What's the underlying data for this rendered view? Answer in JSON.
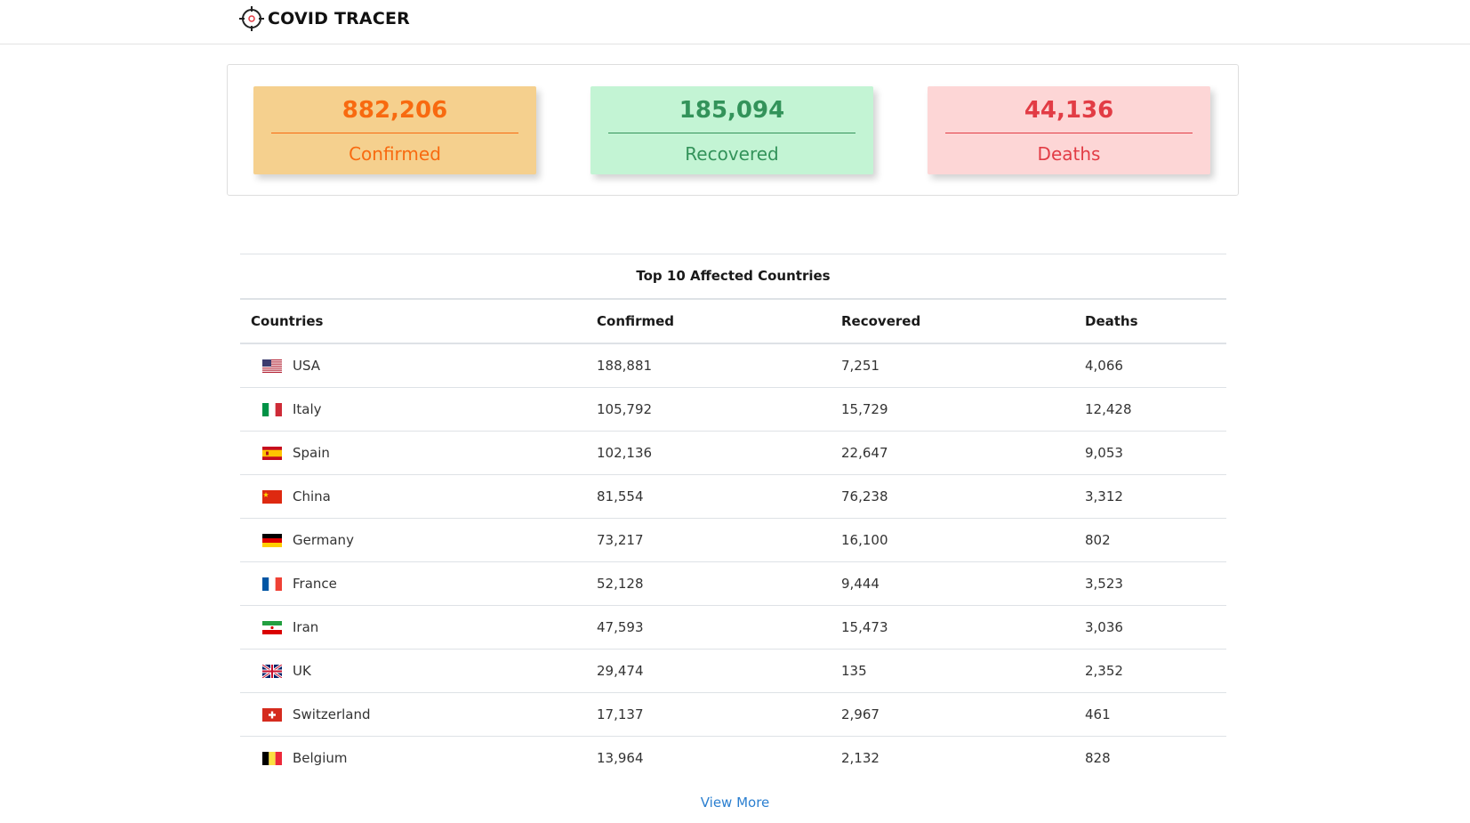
{
  "header": {
    "brand_title": "COVID TRACER",
    "brand_icon": "crosshair-icon"
  },
  "stats": {
    "confirmed": {
      "value": "882,206",
      "label": "Confirmed",
      "color": "#f86a10",
      "bg": "#f5d08e"
    },
    "recovered": {
      "value": "185,094",
      "label": "Recovered",
      "color": "#33935a",
      "bg": "#c3f4d4"
    },
    "deaths": {
      "value": "44,136",
      "label": "Deaths",
      "color": "#e23c45",
      "bg": "#fdd6d6"
    }
  },
  "table": {
    "caption": "Top 10 Affected Countries",
    "columns": [
      "Countries",
      "Confirmed",
      "Recovered",
      "Deaths"
    ],
    "rows": [
      {
        "country": "USA",
        "flag": "us-flag-icon",
        "confirmed": "188,881",
        "recovered": "7,251",
        "deaths": "4,066"
      },
      {
        "country": "Italy",
        "flag": "it-flag-icon",
        "confirmed": "105,792",
        "recovered": "15,729",
        "deaths": "12,428"
      },
      {
        "country": "Spain",
        "flag": "es-flag-icon",
        "confirmed": "102,136",
        "recovered": "22,647",
        "deaths": "9,053"
      },
      {
        "country": "China",
        "flag": "cn-flag-icon",
        "confirmed": "81,554",
        "recovered": "76,238",
        "deaths": "3,312"
      },
      {
        "country": "Germany",
        "flag": "de-flag-icon",
        "confirmed": "73,217",
        "recovered": "16,100",
        "deaths": "802"
      },
      {
        "country": "France",
        "flag": "fr-flag-icon",
        "confirmed": "52,128",
        "recovered": "9,444",
        "deaths": "3,523"
      },
      {
        "country": "Iran",
        "flag": "ir-flag-icon",
        "confirmed": "47,593",
        "recovered": "15,473",
        "deaths": "3,036"
      },
      {
        "country": "UK",
        "flag": "gb-flag-icon",
        "confirmed": "29,474",
        "recovered": "135",
        "deaths": "2,352"
      },
      {
        "country": "Switzerland",
        "flag": "ch-flag-icon",
        "confirmed": "17,137",
        "recovered": "2,967",
        "deaths": "461"
      },
      {
        "country": "Belgium",
        "flag": "be-flag-icon",
        "confirmed": "13,964",
        "recovered": "2,132",
        "deaths": "828"
      }
    ]
  },
  "view_more_label": "View More"
}
